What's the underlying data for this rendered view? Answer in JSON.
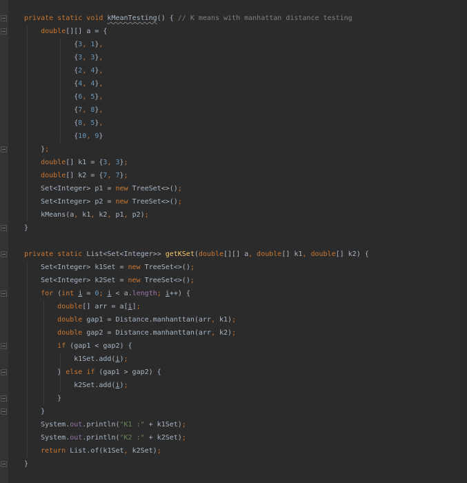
{
  "editor": {
    "colors": {
      "background": "#2b2b2b",
      "keyword": "#cc7832",
      "number": "#6897bb",
      "comment": "#808080",
      "method": "#ffc66d",
      "field": "#9876aa",
      "string": "#6a8759",
      "text": "#a9b7c6"
    },
    "lines": [
      [
        [
          "kw",
          "private static void "
        ],
        [
          "warn",
          "kMeanTesting"
        ],
        [
          "",
          "() { "
        ],
        [
          "cm",
          "// K means with manhattan distance testing"
        ]
      ],
      [
        [
          "",
          "    "
        ],
        [
          "kw",
          "double"
        ],
        [
          "",
          "[][] a = {"
        ]
      ],
      [
        [
          "",
          "            {"
        ],
        [
          "num",
          "3"
        ],
        [
          "kw",
          ", "
        ],
        [
          "num",
          "1"
        ],
        [
          "",
          "}"
        ],
        [
          "kw",
          ","
        ]
      ],
      [
        [
          "",
          "            {"
        ],
        [
          "num",
          "3"
        ],
        [
          "kw",
          ", "
        ],
        [
          "num",
          "3"
        ],
        [
          "",
          "}"
        ],
        [
          "kw",
          ","
        ]
      ],
      [
        [
          "",
          "            {"
        ],
        [
          "num",
          "2"
        ],
        [
          "kw",
          ", "
        ],
        [
          "num",
          "4"
        ],
        [
          "",
          "}"
        ],
        [
          "kw",
          ","
        ]
      ],
      [
        [
          "",
          "            {"
        ],
        [
          "num",
          "4"
        ],
        [
          "kw",
          ", "
        ],
        [
          "num",
          "4"
        ],
        [
          "",
          "}"
        ],
        [
          "kw",
          ","
        ]
      ],
      [
        [
          "",
          "            {"
        ],
        [
          "num",
          "6"
        ],
        [
          "kw",
          ", "
        ],
        [
          "num",
          "5"
        ],
        [
          "",
          "}"
        ],
        [
          "kw",
          ","
        ]
      ],
      [
        [
          "",
          "            {"
        ],
        [
          "num",
          "7"
        ],
        [
          "kw",
          ", "
        ],
        [
          "num",
          "8"
        ],
        [
          "",
          "}"
        ],
        [
          "kw",
          ","
        ]
      ],
      [
        [
          "",
          "            {"
        ],
        [
          "num",
          "8"
        ],
        [
          "kw",
          ", "
        ],
        [
          "num",
          "5"
        ],
        [
          "",
          "}"
        ],
        [
          "kw",
          ","
        ]
      ],
      [
        [
          "",
          "            {"
        ],
        [
          "num",
          "10"
        ],
        [
          "kw",
          ", "
        ],
        [
          "num",
          "9"
        ],
        [
          "",
          "}"
        ]
      ],
      [
        [
          "",
          "    }"
        ],
        [
          "kw",
          ";"
        ]
      ],
      [
        [
          "",
          "    "
        ],
        [
          "kw",
          "double"
        ],
        [
          "",
          "[] k1 = {"
        ],
        [
          "num",
          "3"
        ],
        [
          "kw",
          ", "
        ],
        [
          "num",
          "3"
        ],
        [
          "",
          "}"
        ],
        [
          "kw",
          ";"
        ]
      ],
      [
        [
          "",
          "    "
        ],
        [
          "kw",
          "double"
        ],
        [
          "",
          "[] k2 = {"
        ],
        [
          "num",
          "7"
        ],
        [
          "kw",
          ", "
        ],
        [
          "num",
          "7"
        ],
        [
          "",
          "}"
        ],
        [
          "kw",
          ";"
        ]
      ],
      [
        [
          "",
          "    Set<Integer> p1 = "
        ],
        [
          "kw",
          "new "
        ],
        [
          "",
          "TreeSet<>()"
        ],
        [
          "kw",
          ";"
        ]
      ],
      [
        [
          "",
          "    Set<Integer> p2 = "
        ],
        [
          "kw",
          "new "
        ],
        [
          "",
          "TreeSet<>()"
        ],
        [
          "kw",
          ";"
        ]
      ],
      [
        [
          "",
          "    kMeans(a"
        ],
        [
          "kw",
          ", "
        ],
        [
          "",
          "k1"
        ],
        [
          "kw",
          ", "
        ],
        [
          "",
          "k2"
        ],
        [
          "kw",
          ", "
        ],
        [
          "",
          "p1"
        ],
        [
          "kw",
          ", "
        ],
        [
          "",
          "p2)"
        ],
        [
          "kw",
          ";"
        ]
      ],
      [
        [
          "",
          "}"
        ]
      ],
      [
        [
          "",
          ""
        ]
      ],
      [
        [
          "kw",
          "private static "
        ],
        [
          "",
          "List<Set<Integer>> "
        ],
        [
          "fn",
          "getKSet"
        ],
        [
          "",
          "("
        ],
        [
          "kw",
          "double"
        ],
        [
          "",
          "[][] a"
        ],
        [
          "kw",
          ", double"
        ],
        [
          "",
          "[] k1"
        ],
        [
          "kw",
          ", double"
        ],
        [
          "",
          "[] k2) {"
        ]
      ],
      [
        [
          "",
          "    Set<Integer> k1Set = "
        ],
        [
          "kw",
          "new "
        ],
        [
          "",
          "TreeSet<>()"
        ],
        [
          "kw",
          ";"
        ]
      ],
      [
        [
          "",
          "    Set<Integer> k2Set = "
        ],
        [
          "kw",
          "new "
        ],
        [
          "",
          "TreeSet<>()"
        ],
        [
          "kw",
          ";"
        ]
      ],
      [
        [
          "",
          "    "
        ],
        [
          "kw",
          "for "
        ],
        [
          "",
          "("
        ],
        [
          "kw",
          "int "
        ],
        [
          "ul",
          "i"
        ],
        [
          "",
          " = "
        ],
        [
          "num",
          "0"
        ],
        [
          "kw",
          "; "
        ],
        [
          "ul",
          "i"
        ],
        [
          "",
          " < a."
        ],
        [
          "fld",
          "length"
        ],
        [
          "kw",
          "; "
        ],
        [
          "ul",
          "i"
        ],
        [
          "",
          "++) {"
        ]
      ],
      [
        [
          "",
          "        "
        ],
        [
          "kw",
          "double"
        ],
        [
          "",
          "[] arr = a["
        ],
        [
          "ul",
          "i"
        ],
        [
          "",
          "]"
        ],
        [
          "kw",
          ";"
        ]
      ],
      [
        [
          "",
          "        "
        ],
        [
          "kw",
          "double "
        ],
        [
          "",
          "gap1 = Distance."
        ],
        [
          "",
          "manhanttan(arr"
        ],
        [
          "kw",
          ", "
        ],
        [
          "",
          "k1)"
        ],
        [
          "kw",
          ";"
        ]
      ],
      [
        [
          "",
          "        "
        ],
        [
          "kw",
          "double "
        ],
        [
          "",
          "gap2 = Distance."
        ],
        [
          "",
          "manhanttan(arr"
        ],
        [
          "kw",
          ", "
        ],
        [
          "",
          "k2)"
        ],
        [
          "kw",
          ";"
        ]
      ],
      [
        [
          "",
          "        "
        ],
        [
          "kw",
          "if "
        ],
        [
          "",
          "(gap1 < gap2) {"
        ]
      ],
      [
        [
          "",
          "            k1Set.add("
        ],
        [
          "ul",
          "i"
        ],
        [
          "",
          ")"
        ],
        [
          "kw",
          ";"
        ]
      ],
      [
        [
          "",
          "        } "
        ],
        [
          "kw",
          "else if "
        ],
        [
          "",
          "(gap1 > gap2) {"
        ]
      ],
      [
        [
          "",
          "            k2Set.add("
        ],
        [
          "ul",
          "i"
        ],
        [
          "",
          ")"
        ],
        [
          "kw",
          ";"
        ]
      ],
      [
        [
          "",
          "        }"
        ]
      ],
      [
        [
          "",
          "    }"
        ]
      ],
      [
        [
          "",
          "    System."
        ],
        [
          "fld",
          "out"
        ],
        [
          "",
          ".println("
        ],
        [
          "str",
          "\"K1 :\""
        ],
        [
          "",
          " + k1Set)"
        ],
        [
          "kw",
          ";"
        ]
      ],
      [
        [
          "",
          "    System."
        ],
        [
          "fld",
          "out"
        ],
        [
          "",
          ".println("
        ],
        [
          "str",
          "\"K2 :\""
        ],
        [
          "",
          " + k2Set)"
        ],
        [
          "kw",
          ";"
        ]
      ],
      [
        [
          "",
          "    "
        ],
        [
          "kw",
          "return "
        ],
        [
          "",
          "List."
        ],
        [
          "",
          "of(k1Set"
        ],
        [
          "kw",
          ", "
        ],
        [
          "",
          "k2Set)"
        ],
        [
          "kw",
          ";"
        ]
      ],
      [
        [
          "",
          "}"
        ]
      ]
    ]
  }
}
